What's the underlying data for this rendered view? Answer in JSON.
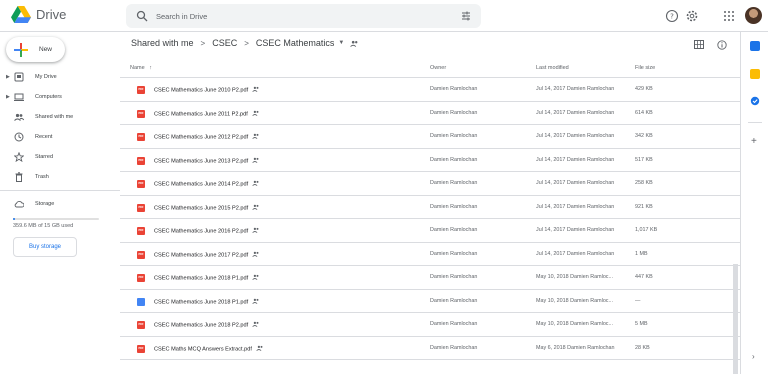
{
  "app": {
    "title": "Drive"
  },
  "search": {
    "placeholder": "Search in Drive"
  },
  "sidebar": {
    "new_label": "New",
    "items": [
      {
        "label": "My Drive",
        "icon": "my-drive-icon"
      },
      {
        "label": "Computers",
        "icon": "computers-icon"
      },
      {
        "label": "Shared with me",
        "icon": "shared-with-me-icon"
      },
      {
        "label": "Recent",
        "icon": "recent-icon"
      },
      {
        "label": "Starred",
        "icon": "star-icon"
      },
      {
        "label": "Trash",
        "icon": "trash-icon"
      }
    ],
    "storage_label": "Storage",
    "storage_used": "359.6 MB of 15 GB used",
    "storage_fraction": 0.023,
    "buy_storage": "Buy storage"
  },
  "breadcrumb": {
    "items": [
      "Shared with me",
      "CSEC",
      "CSEC Mathematics"
    ],
    "separator": ">"
  },
  "list": {
    "headers": {
      "name": "Name",
      "owner": "Owner",
      "modified": "Last modified",
      "size": "File size"
    },
    "rows": [
      {
        "name": "CSEC Mathematics June 2010 P2.pdf",
        "type": "pdf",
        "owner": "Damien Ramlochan",
        "modified": "Jul 14, 2017 Damien Ramlochan",
        "size": "429 KB"
      },
      {
        "name": "CSEC Mathematics June 2011 P2.pdf",
        "type": "pdf",
        "owner": "Damien Ramlochan",
        "modified": "Jul 14, 2017 Damien Ramlochan",
        "size": "614 KB"
      },
      {
        "name": "CSEC Mathematics June 2012 P2.pdf",
        "type": "pdf",
        "owner": "Damien Ramlochan",
        "modified": "Jul 14, 2017 Damien Ramlochan",
        "size": "342 KB"
      },
      {
        "name": "CSEC Mathematics June 2013 P2.pdf",
        "type": "pdf",
        "owner": "Damien Ramlochan",
        "modified": "Jul 14, 2017 Damien Ramlochan",
        "size": "517 KB"
      },
      {
        "name": "CSEC Mathematics June 2014 P2.pdf",
        "type": "pdf",
        "owner": "Damien Ramlochan",
        "modified": "Jul 14, 2017 Damien Ramlochan",
        "size": "258 KB"
      },
      {
        "name": "CSEC Mathematics June 2015 P2.pdf",
        "type": "pdf",
        "owner": "Damien Ramlochan",
        "modified": "Jul 14, 2017 Damien Ramlochan",
        "size": "921 KB"
      },
      {
        "name": "CSEC Mathematics June 2016 P2.pdf",
        "type": "pdf",
        "owner": "Damien Ramlochan",
        "modified": "Jul 14, 2017 Damien Ramlochan",
        "size": "1,017 KB"
      },
      {
        "name": "CSEC Mathematics June 2017 P2.pdf",
        "type": "pdf",
        "owner": "Damien Ramlochan",
        "modified": "Jul 14, 2017 Damien Ramlochan",
        "size": "1 MB"
      },
      {
        "name": "CSEC Mathematics June 2018 P1.pdf",
        "type": "pdf",
        "owner": "Damien Ramlochan",
        "modified": "May 10, 2018 Damien Ramloc...",
        "size": "447 KB"
      },
      {
        "name": "CSEC Mathematics June 2018 P1.pdf",
        "type": "doc",
        "owner": "Damien Ramlochan",
        "modified": "May 10, 2018 Damien Ramloc...",
        "size": "—"
      },
      {
        "name": "CSEC Mathematics June 2018 P2.pdf",
        "type": "pdf",
        "owner": "Damien Ramlochan",
        "modified": "May 10, 2018 Damien Ramloc...",
        "size": "5 MB"
      },
      {
        "name": "CSEC Maths MCQ Answers Extract.pdf",
        "type": "pdf",
        "owner": "Damien Ramlochan",
        "modified": "May 6, 2018 Damien Ramlochan",
        "size": "28 KB"
      }
    ]
  },
  "colors": {
    "accent": "#1a73e8",
    "pdf": "#ea4335",
    "doc": "#4285f4"
  }
}
